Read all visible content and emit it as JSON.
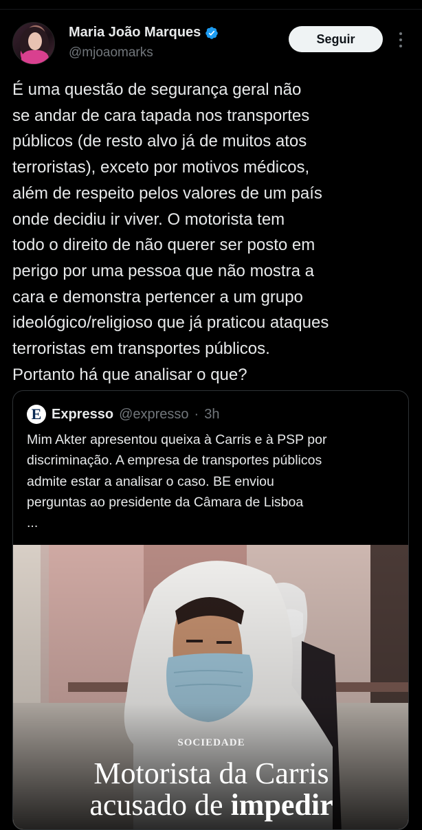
{
  "author": {
    "name": "Maria João Marques",
    "handle": "@mjoaomarks",
    "follow_label": "Seguir"
  },
  "tweet": {
    "lines": [
      "É uma questão de segurança geral não",
      "se andar de cara tapada nos transportes",
      "públicos (de resto alvo já de muitos atos",
      "terroristas), exceto por motivos médicos,",
      "além de respeito pelos valores de um país",
      "onde decidiu ir viver. O motorista tem",
      "todo o direito de não querer ser posto em",
      "perigo por uma pessoa que não mostra a",
      "cara e demonstra pertencer a um grupo",
      "ideológico/religioso que já praticou ataques",
      "terroristas em transportes públicos.",
      "Portanto há que analisar o que?"
    ]
  },
  "quoted": {
    "logo_letter": "E",
    "name": "Expresso",
    "handle": "@expresso",
    "separator": "·",
    "time": "3h",
    "lines": [
      "Mim Akter apresentou queixa à Carris e à PSP por",
      "discriminação. A empresa de transportes públicos",
      "admite estar a analisar o caso. BE enviou",
      "perguntas ao presidente da Câmara de Lisboa",
      "..."
    ],
    "image": {
      "section": "SOCIEDADE",
      "headline_line1": "Motorista da Carris",
      "headline_line2_plain": "acusado de ",
      "headline_line2_bold": "impedir"
    }
  },
  "colors": {
    "background": "#000000",
    "text": "#e7e9ea",
    "secondary": "#71767b",
    "verified": "#1d9bf0",
    "border": "#2f3336"
  },
  "icons": [
    "verified-badge-icon",
    "more-options-icon",
    "expresso-logo-icon"
  ]
}
